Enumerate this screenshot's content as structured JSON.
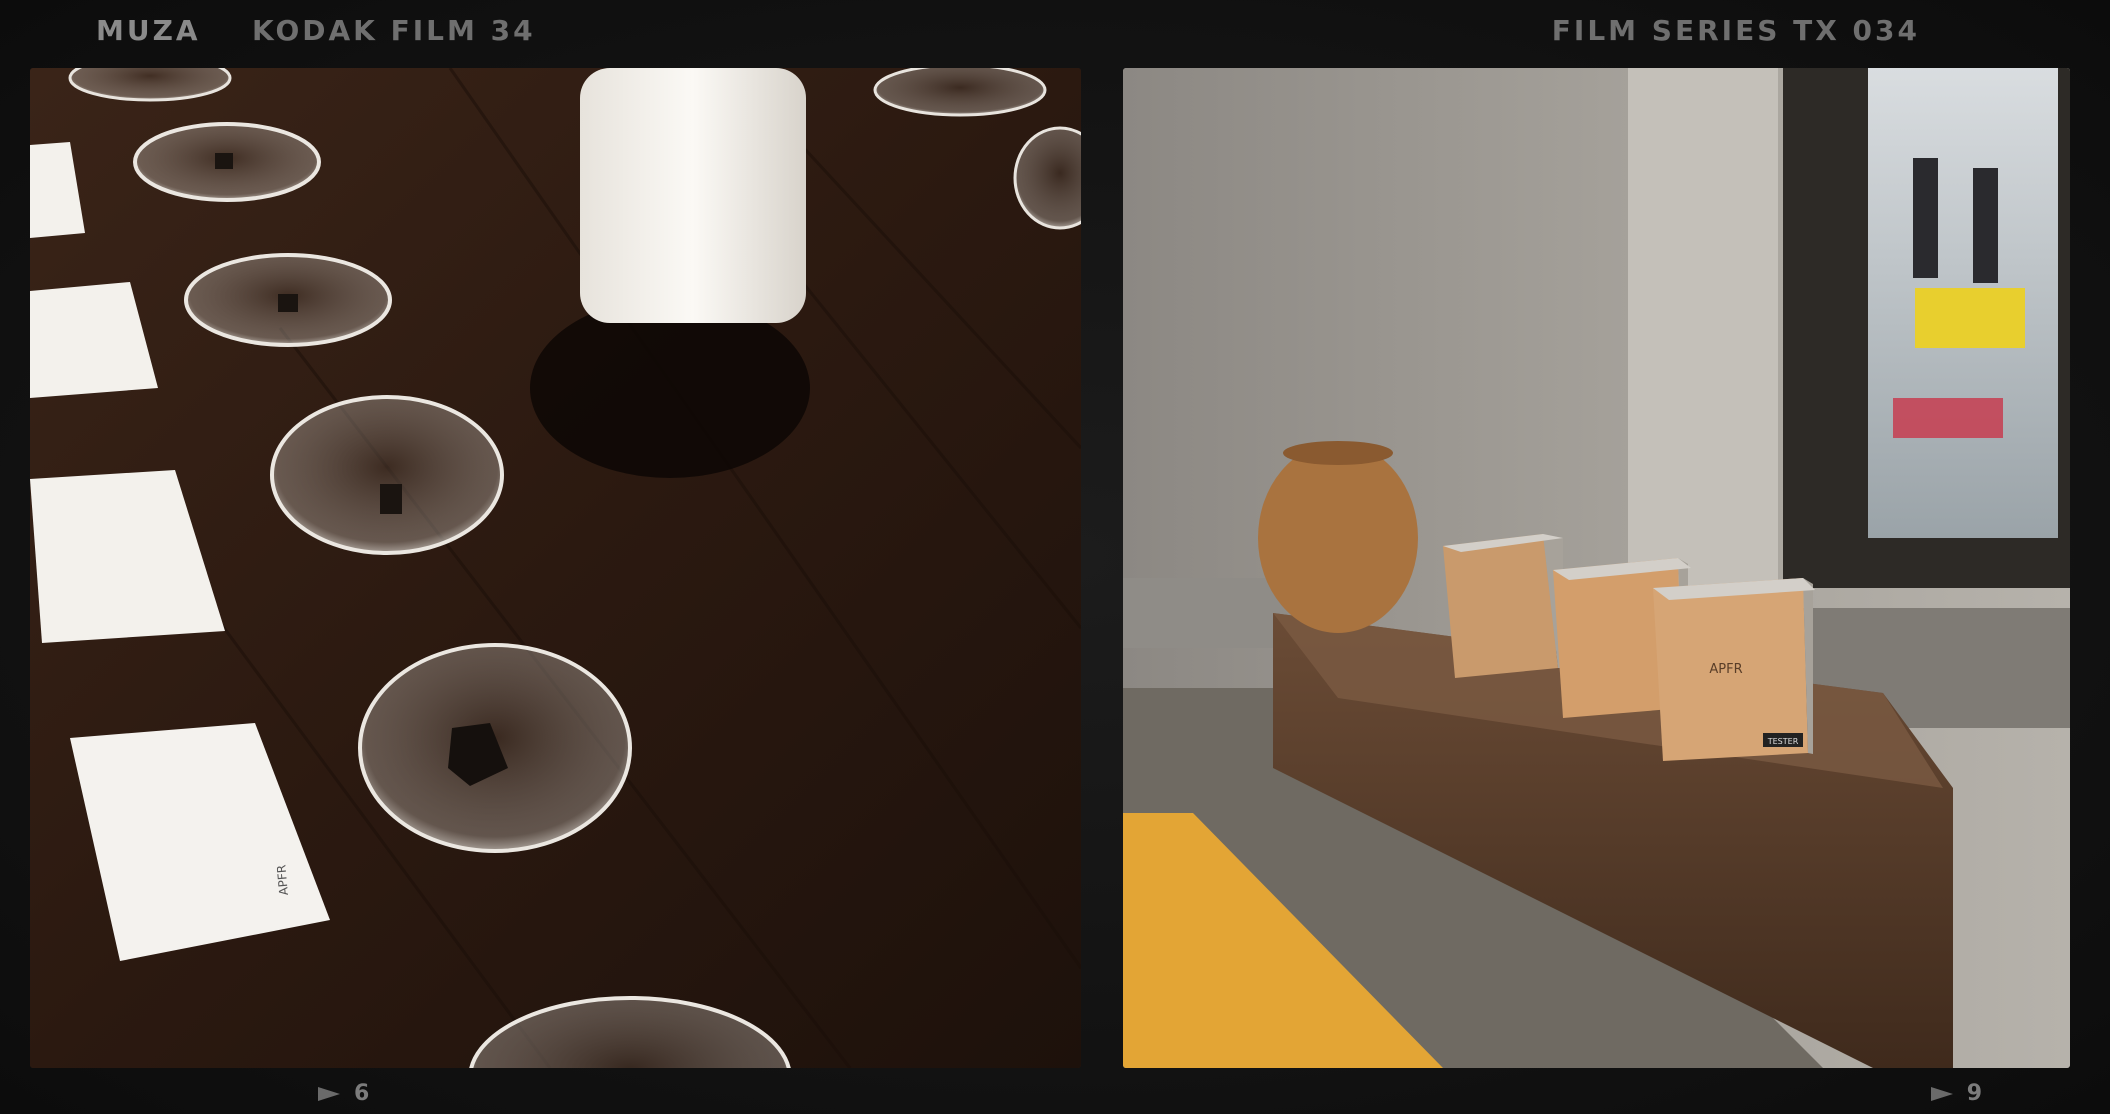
{
  "film_edge": {
    "brand": "MUZA",
    "stock": "KODAK FILM 34",
    "series": "FILM SERIES TX 034"
  },
  "frames": [
    {
      "number": "6",
      "card_label": "APFR"
    },
    {
      "number": "9",
      "box_label": "APFR",
      "tester_label": "TESTER"
    }
  ],
  "colors": {
    "film_base": "#131313",
    "edge_text": "#6f6f6f",
    "wood_table": "#2a1a12",
    "wall": "#a09c95",
    "mustard": "#e3a535"
  }
}
